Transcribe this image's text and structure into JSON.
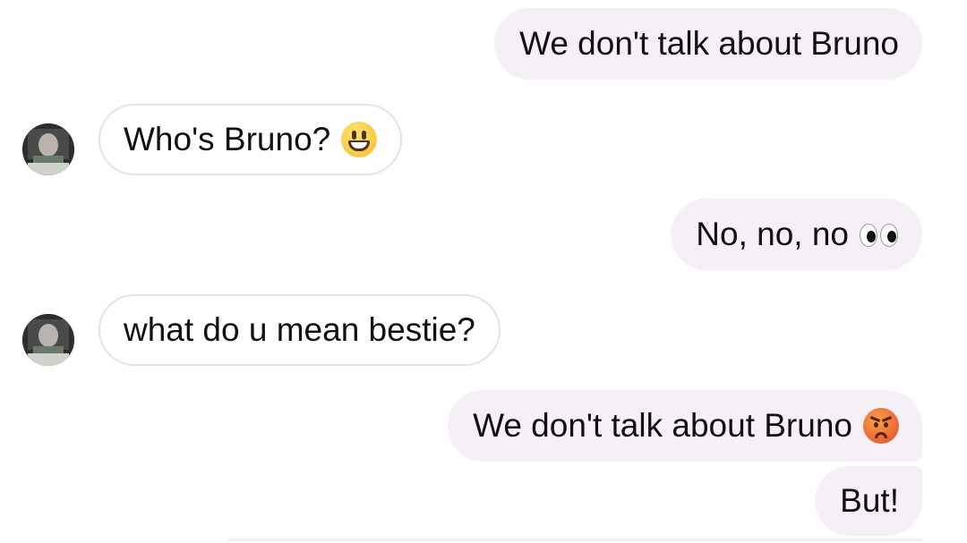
{
  "chat": {
    "messages": [
      {
        "side": "outgoing",
        "text": "We don't talk about Bruno",
        "emoji": ""
      },
      {
        "side": "incoming",
        "text": "Who's Bruno?",
        "emoji": "grinning-face-icon"
      },
      {
        "side": "outgoing",
        "text": "No, no, no",
        "emoji": "eyes-icon"
      },
      {
        "side": "incoming",
        "text": "what do u mean bestie?",
        "emoji": ""
      },
      {
        "side": "outgoing",
        "text": "We don't talk about Bruno",
        "emoji": "angry-face-icon"
      },
      {
        "side": "outgoing",
        "text": "But!",
        "emoji": ""
      }
    ]
  },
  "colors": {
    "outgoing_bubble": "#f5f0f6",
    "incoming_bubble": "#ffffff",
    "incoming_border": "#e6e0e8",
    "text": "#111111"
  }
}
